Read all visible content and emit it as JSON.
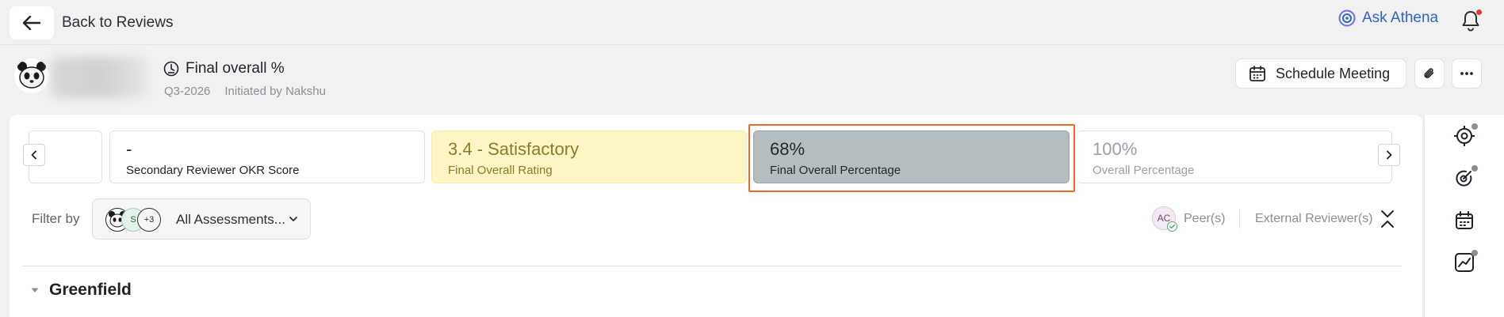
{
  "topbar": {
    "back_label": "Back to Reviews",
    "ask_label": "Ask Athena"
  },
  "header": {
    "title": "Final overall %",
    "period": "Q3-2026",
    "initiated": "Initiated by Nakshu",
    "schedule_label": "Schedule Meeting"
  },
  "scores": [
    {
      "value": "-",
      "label": "Secondary Reviewer OKR Score"
    },
    {
      "value": "3.4 - Satisfactory",
      "label": "Final Overall Rating"
    },
    {
      "value": "68%",
      "label": "Final Overall Percentage"
    },
    {
      "value": "100%",
      "label": "Overall Percentage"
    }
  ],
  "filter": {
    "label": "Filter by",
    "avatar_s": "S",
    "more_count": "+3",
    "selected": "All Assessments...",
    "peer_initials": "AC",
    "peer_label": "Peer(s)",
    "external_label": "External Reviewer(s)"
  },
  "section": {
    "title": "Greenfield"
  },
  "colors": {
    "accent_blue": "#2f64c9",
    "highlight_orange": "#ec6a2b",
    "rating_yellow": "#fbf6c4",
    "selected_grey": "#b4bdbf",
    "notification_red": "#e53935"
  }
}
